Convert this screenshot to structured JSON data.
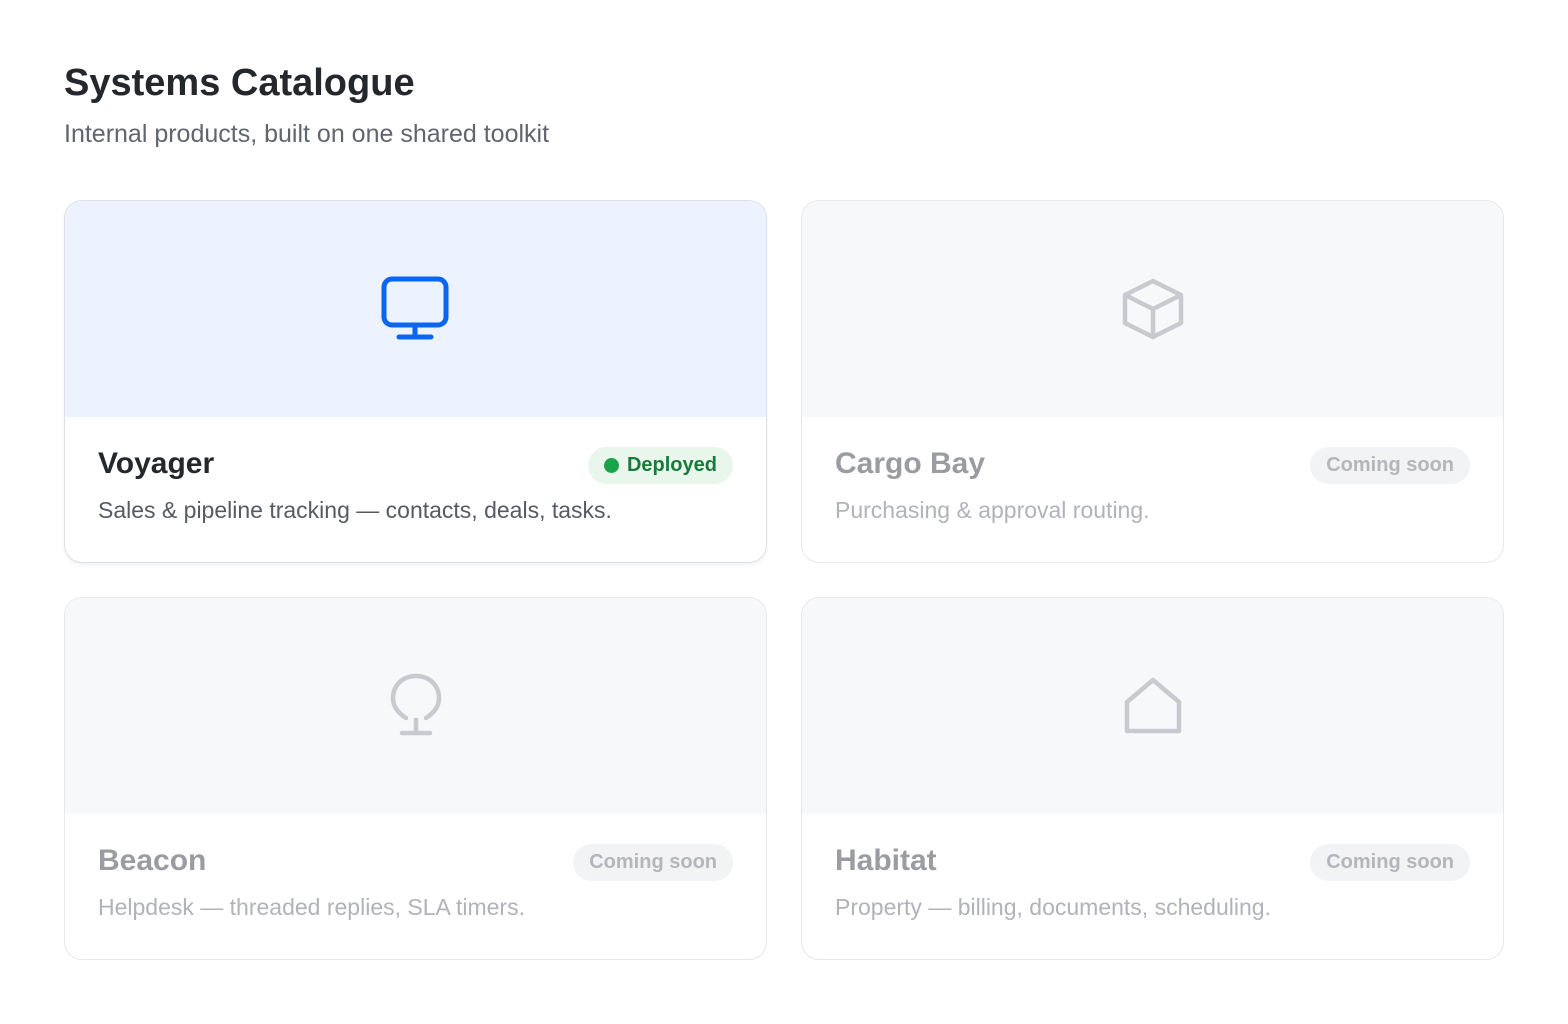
{
  "header": {
    "title": "Systems Catalogue",
    "subtitle": "Internal products, built on one shared toolkit"
  },
  "colors": {
    "accent": "#0a66f0",
    "deployed_text": "#1a7a3c",
    "deployed_dot": "#1aa34a",
    "muted_icon": "#c8cacf"
  },
  "cards": [
    {
      "name": "Voyager",
      "description": "Sales & pipeline tracking — contacts, deals, tasks.",
      "status": "Deployed",
      "icon": "monitor-icon",
      "active": true
    },
    {
      "name": "Cargo Bay",
      "description": "Purchasing & approval routing.",
      "status": "Coming soon",
      "icon": "box-icon",
      "active": false
    },
    {
      "name": "Beacon",
      "description": "Helpdesk — threaded replies, SLA timers.",
      "status": "Coming soon",
      "icon": "lightbulb-icon",
      "active": false
    },
    {
      "name": "Habitat",
      "description": "Property — billing, documents, scheduling.",
      "status": "Coming soon",
      "icon": "house-icon",
      "active": false
    }
  ]
}
